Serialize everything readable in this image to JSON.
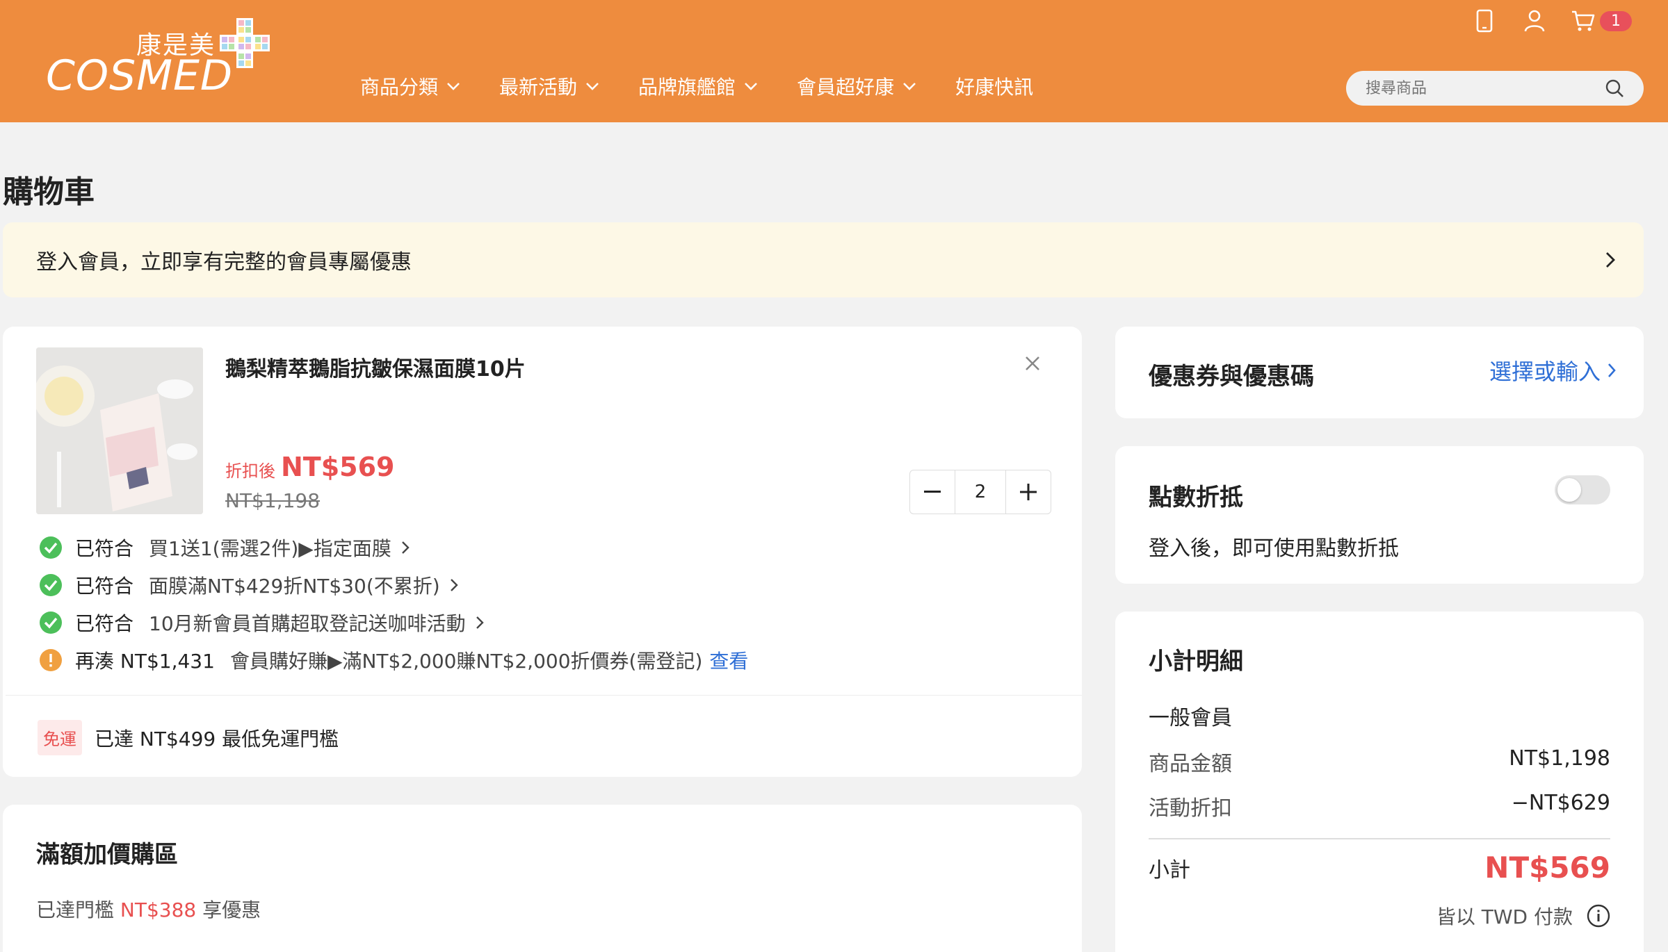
{
  "header": {
    "logo_cn": "康是美",
    "logo_en": "COSMED",
    "nav": [
      {
        "label": "商品分類",
        "has_dropdown": true
      },
      {
        "label": "最新活動",
        "has_dropdown": true
      },
      {
        "label": "品牌旗艦館",
        "has_dropdown": true
      },
      {
        "label": "會員超好康",
        "has_dropdown": true
      },
      {
        "label": "好康快訊",
        "has_dropdown": false
      }
    ],
    "cart_count": "1",
    "search_placeholder": "搜尋商品",
    "icons": [
      "mobile-icon",
      "user-icon",
      "cart-icon",
      "search-icon"
    ]
  },
  "page": {
    "title": "購物車",
    "login_banner": "登入會員，立即享有完整的會員專屬優惠"
  },
  "cart_item": {
    "name": "鵝梨精萃鵝脂抗皺保濕面膜10片",
    "price_label": "折扣後",
    "price_now": "NT$569",
    "price_old": "NT$1,198",
    "quantity": "2",
    "promos": [
      {
        "status": "已符合",
        "desc": "買1送1(需選2件)▶指定面膜",
        "type": "ok"
      },
      {
        "status": "已符合",
        "desc": "面膜滿NT$429折NT$30(不累折)",
        "type": "ok"
      },
      {
        "status": "已符合",
        "desc": "10月新會員首購超取登記送咖啡活動",
        "type": "ok"
      },
      {
        "status": "再湊 NT$1,431",
        "desc": "會員購好賺▶滿NT$2,000賺NT$2,000折價券(需登記)",
        "type": "warn",
        "link": "查看"
      }
    ],
    "shipping_tag": "免運",
    "shipping_text": "已達 NT$499 最低免運門檻"
  },
  "addon": {
    "title": "滿額加價購區",
    "sub_prefix": "已達門檻",
    "sub_amount": "NT$388",
    "sub_suffix": "享優惠"
  },
  "coupon": {
    "title": "優惠券與優惠碼",
    "link": "選擇或輸入"
  },
  "points": {
    "title": "點數折抵",
    "desc": "登入後，即可使用點數折抵",
    "enabled": false
  },
  "summary": {
    "title": "小計明細",
    "tier": "一般會員",
    "rows": [
      {
        "label": "商品金額",
        "value": "NT$1,198"
      },
      {
        "label": "活動折扣",
        "value": "−NT$629"
      }
    ],
    "subtotal_label": "小計",
    "subtotal_value": "NT$569",
    "currency_note": "皆以 TWD 付款"
  },
  "colors": {
    "brand_orange": "#ee8c3e",
    "price_red": "#e85050",
    "link_blue": "#2f6fd6",
    "ok_green": "#4cbf5a",
    "warn_orange": "#f0a040"
  }
}
